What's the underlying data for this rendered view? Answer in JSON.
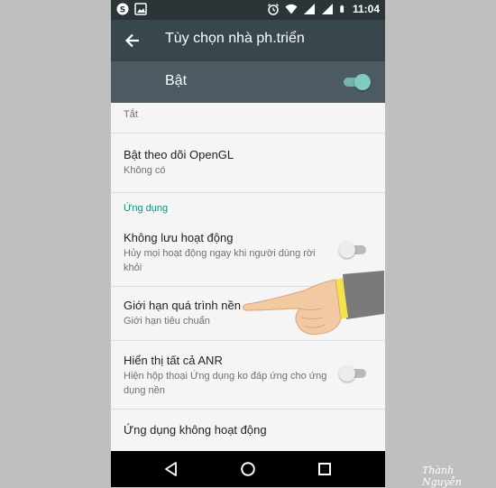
{
  "status_bar": {
    "time": "11:04",
    "left_icons": [
      "skype-icon",
      "image-icon"
    ],
    "right_icons": [
      "alarm-icon",
      "wifi-icon",
      "signal-icon",
      "signal-icon",
      "battery-icon"
    ]
  },
  "app_bar": {
    "title": "Tùy chọn nhà ph.triển",
    "back_icon": "arrow-back-icon"
  },
  "master": {
    "label": "Bật",
    "toggle_on": true,
    "accent": "#80cbc4"
  },
  "items": [
    {
      "title": "Tắt"
    },
    {
      "title": "Bật theo dõi OpenGL",
      "summary": "Không có"
    },
    {
      "section": "Ứng dụng"
    },
    {
      "title": "Không lưu hoạt động",
      "summary": "Hủy mọi hoạt động ngay khi người dùng rời khỏi",
      "toggle_on": false
    },
    {
      "title": "Giới hạn quá trình nền",
      "summary": "Giới hạn tiêu chuẩn"
    },
    {
      "title": "Hiển thị tất cả ANR",
      "summary": "Hiện hộp thoại Ứng dụng ko đáp ứng cho ứng dụng nền",
      "toggle_on": false
    },
    {
      "title": "Ứng dụng không hoạt động"
    }
  ],
  "nav_bar": {
    "icons": [
      "back-triangle-icon",
      "home-circle-icon",
      "recents-square-icon"
    ]
  },
  "watermark": "Thành Nguyễn",
  "colors": {
    "app_bar": "#37474c",
    "status_bar": "#2b3437",
    "master_bar": "#4b5b61",
    "section": "#009688"
  }
}
